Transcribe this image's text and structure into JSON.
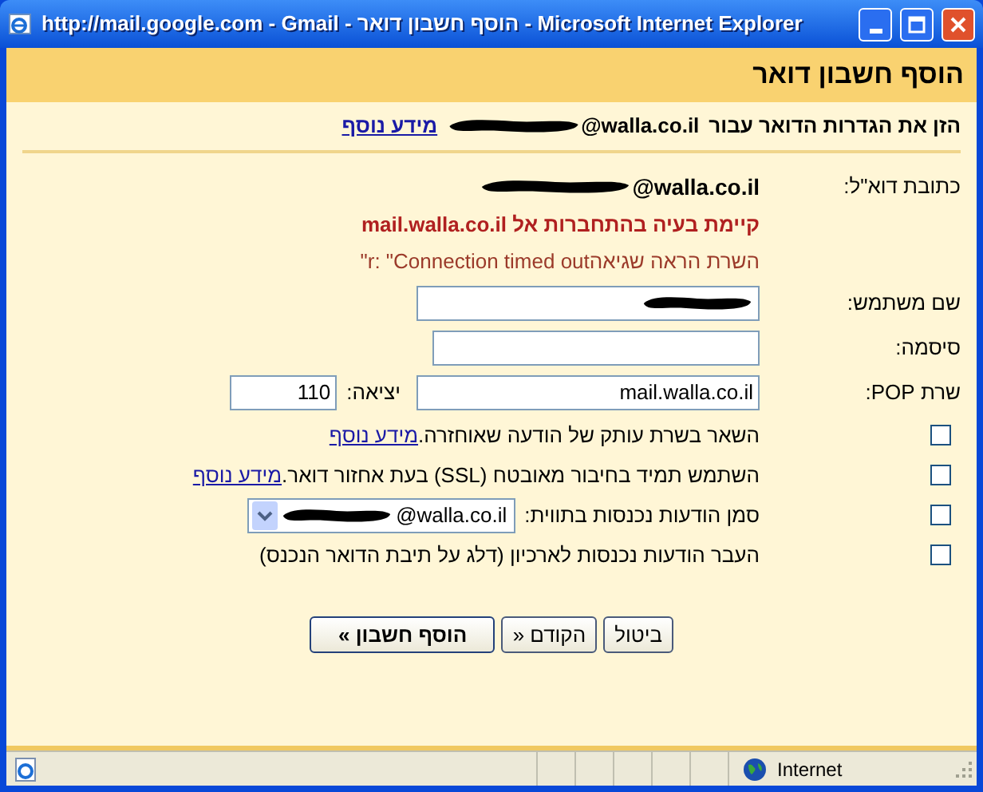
{
  "window": {
    "title": "http://mail.google.com - Gmail - הוסף חשבון דואר - Microsoft Internet Explorer"
  },
  "dialog": {
    "title": "הוסף חשבון דואר",
    "intro": {
      "text": "הזן את הגדרות הדואר עבור",
      "email_suffix": "@walla.co.il",
      "redacted": true,
      "link": "מידע נוסף"
    }
  },
  "email": {
    "label": "כתובת דוא\"ל:",
    "value": "@walla.co.il",
    "redacted": true
  },
  "error": {
    "title": "קיימת בעיה בהתחברות אל mail.walla.co.il",
    "detail": "השרת הראה שגיאהr: \"Connection timed out\""
  },
  "username": {
    "label": "שם משתמש:",
    "redacted": true
  },
  "password": {
    "label": "סיסמה:"
  },
  "pop": {
    "label": "שרת POP:",
    "value": "mail.walla.co.il",
    "port_label": "יציאה:",
    "port": "110"
  },
  "options": [
    {
      "kind": "text",
      "text": "השאר בשרת עותק של הודעה שאוחזרה.",
      "link": "מידע נוסף",
      "checked": false
    },
    {
      "kind": "text",
      "text": "השתמש תמיד בחיבור מאובטח (SSL) בעת אחזור דואר.",
      "link": "מידע נוסף",
      "checked": false
    },
    {
      "kind": "select",
      "text": "סמן הודעות נכנסות בתווית:",
      "select_value": "@walla.co.il",
      "redacted": true,
      "checked": false
    },
    {
      "kind": "text",
      "text": "העבר הודעות נכנסות לארכיון (דלג על תיבת הדואר הנכנס)",
      "checked": false
    }
  ],
  "buttons": [
    {
      "label": "ביטול",
      "kind": "normal"
    },
    {
      "label": "הקודם «",
      "kind": "normal"
    },
    {
      "label": "הוסף חשבון »",
      "kind": "primary"
    }
  ],
  "status_bar": {
    "zone": "Internet"
  }
}
